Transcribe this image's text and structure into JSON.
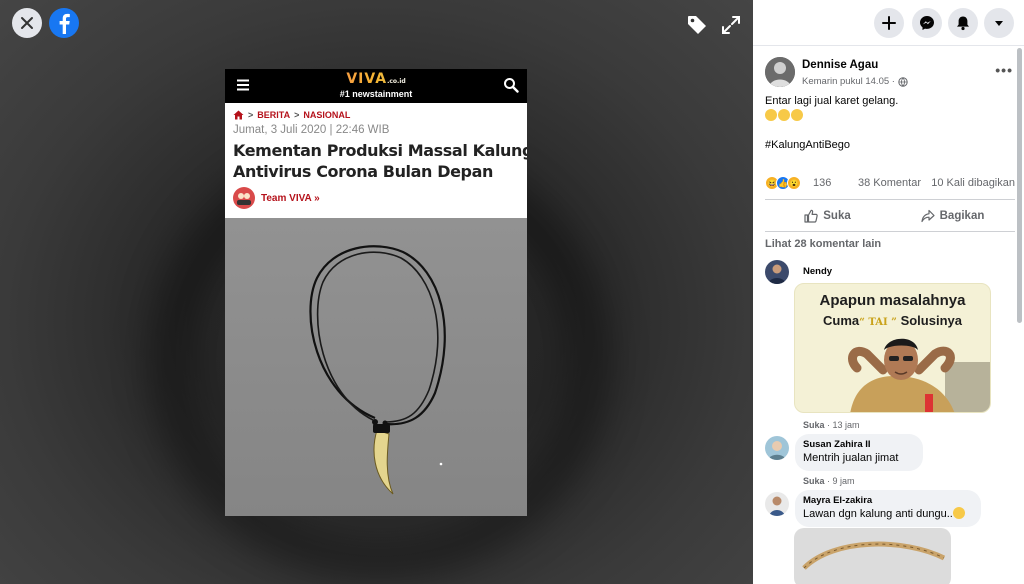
{
  "viewer": {
    "close_icon": "close-icon",
    "logo_icon": "facebook-logo-icon",
    "tag_icon": "tag-icon",
    "fullscreen_icon": "expand-icon"
  },
  "article": {
    "site_logo": "VIVA",
    "site_logo_suffix": ".co.id",
    "site_tagline": "#1 newstainment",
    "breadcrumb": [
      "BERITA",
      "NASIONAL"
    ],
    "date": "Jumat, 3 Juli 2020 | 22:46 WIB",
    "title_line1": "Kementan Produksi Massal Kalung",
    "title_line2": "Antivirus Corona Bulan Depan",
    "author": "Team VIVA »"
  },
  "post": {
    "author": "Dennise Agau",
    "time": "Kemarin pukul 14.05 ·",
    "text_line1": "Entar lagi jual karet gelang.",
    "hashtag": "#KalungAntiBego",
    "reaction_count": "136",
    "comments_count": "38 Komentar",
    "shares_count": "10 Kali dibagikan",
    "like_label": "Suka",
    "share_label": "Bagikan",
    "more_comments": "Lihat 28 komentar lain"
  },
  "comments": [
    {
      "name": "Nendy",
      "sticker_line1": "Apapun masalahnya",
      "sticker_line2a": "Cuma",
      "sticker_tai": "“ TAI ”",
      "sticker_line2b": "Solusinya",
      "like": "Suka",
      "time": "· 13 jam"
    },
    {
      "name": "Susan Zahira II",
      "text": "Mentrih jualan jimat",
      "like": "Suka",
      "time": "· 9 jam"
    },
    {
      "name": "Mayra El-zakira",
      "text": "Lawan dgn kalung anti dungu.."
    }
  ],
  "colors": {
    "facebook_blue": "#1877f2",
    "viva_red": "#b5121b",
    "panel_bg": "#ffffff"
  }
}
